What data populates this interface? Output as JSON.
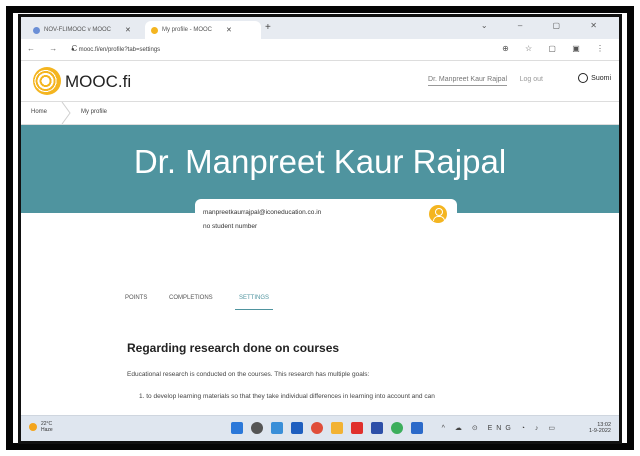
{
  "browser": {
    "tabs": [
      {
        "label": "NOV-FLIMOOC v MOOC",
        "fav_color": "#6b8fd6"
      },
      {
        "label": "My profile - MOOC",
        "fav_color": "#f4b520"
      }
    ],
    "new_tab_glyph": "+",
    "window_controls": "⌄ – ▢ ✕",
    "nav_glyphs": "← → C",
    "url": "mooc.fi/en/profile?tab=settings",
    "tool_glyphs": "⊕ ☆ ▢ ▣ ⋮"
  },
  "site": {
    "logo_text": "MOOC.fi",
    "user_link": "Dr. Manpreet Kaur Rajpal",
    "logout_label": "Log out",
    "language_label": "Suomi"
  },
  "breadcrumb": {
    "home": "Home",
    "current": "My profile"
  },
  "profile": {
    "name": "Dr. Manpreet Kaur Rajpal",
    "email": "manpreetkaurrajpal@iconeducation.co.in",
    "student_number": "no student number"
  },
  "profile_tabs": [
    {
      "label": "POINTS"
    },
    {
      "label": "COMPLETIONS"
    },
    {
      "label": "SETTINGS"
    }
  ],
  "settings": {
    "title": "Regarding research done on courses",
    "paragraph": "Educational research is conducted on the courses. This research has multiple goals:",
    "item_1": "1. to develop learning materials so that they take individual differences in learning into account and can"
  },
  "taskbar": {
    "weather_temp": "22°C",
    "weather_desc": "Haze",
    "tray_glyphs": "^ ☁ ⊙ ENG ◔ ♪ ▭",
    "lang_code": "ENG",
    "time": "13:02",
    "date": "1-9-2022"
  },
  "colors": {
    "banner": "#4f949f",
    "accent": "#f4b520",
    "taskbar_icons": [
      "#2b78d9",
      "#555555",
      "#3a8fd8",
      "#1f5fbf",
      "#e04e3a",
      "#f2b233",
      "#e0302d",
      "#2d4fa8",
      "#3cae5c",
      "#2c6ac9"
    ]
  }
}
